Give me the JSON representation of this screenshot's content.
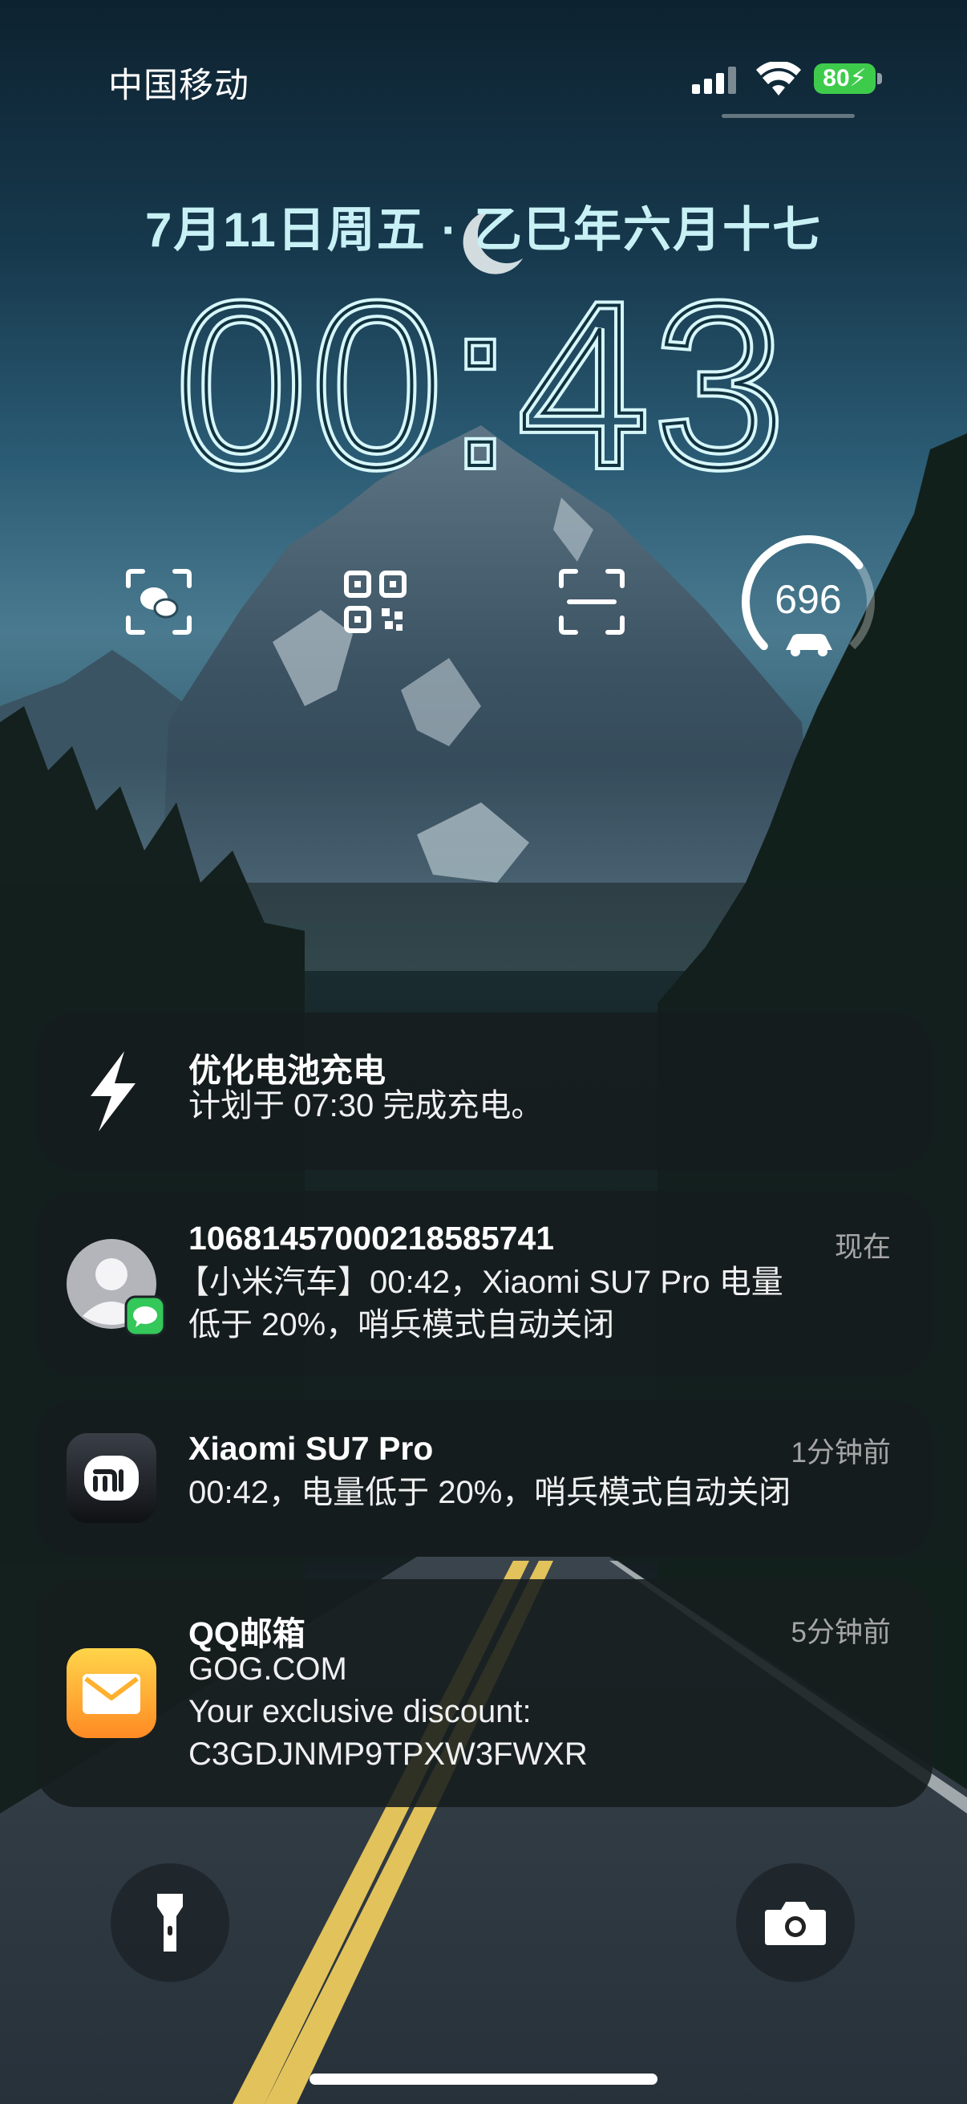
{
  "status_bar": {
    "carrier": "中国移动",
    "battery_level": "80",
    "icons": [
      "signal-icon",
      "wifi-icon",
      "battery-charging-icon"
    ]
  },
  "lock_screen": {
    "date": "7月11日周五 · 乙巳年六月十七",
    "time": "00:43",
    "widgets": [
      "wechat-scan-icon",
      "qr-code-icon",
      "scan-icon",
      "car-battery-gauge"
    ],
    "car_range": "696",
    "car_range_level": 0.7
  },
  "notifications": [
    {
      "title": "优化电池充电",
      "body": [
        "计划于 07:30 完成充电。"
      ],
      "time": "",
      "icon": "lightning-icon"
    },
    {
      "title": "10681457000218585741",
      "body": [
        "【小米汽车】00:42，Xiaomi SU7 Pro 电量",
        "低于 20%，哨兵模式自动关闭"
      ],
      "time": "现在",
      "icon": "contact-avatar-icon"
    },
    {
      "title": "Xiaomi SU7 Pro",
      "body": [
        "00:42，电量低于 20%，哨兵模式自动关闭"
      ],
      "time": "1分钟前",
      "icon": "xiaomi-logo-icon"
    },
    {
      "title": "QQ邮箱",
      "body": [
        "GOG.COM",
        "Your exclusive discount:",
        "C3GDJNMP9TPXW3FWXR"
      ],
      "time": "5分钟前",
      "icon": "mail-icon"
    }
  ],
  "bottom_controls": [
    "flashlight-icon",
    "camera-icon"
  ],
  "colors": {
    "accent_cyan": "#c8f1f6",
    "battery_green": "#3ecb4c",
    "message_green": "#34c759",
    "mail_yellow": "#ffc93c"
  }
}
